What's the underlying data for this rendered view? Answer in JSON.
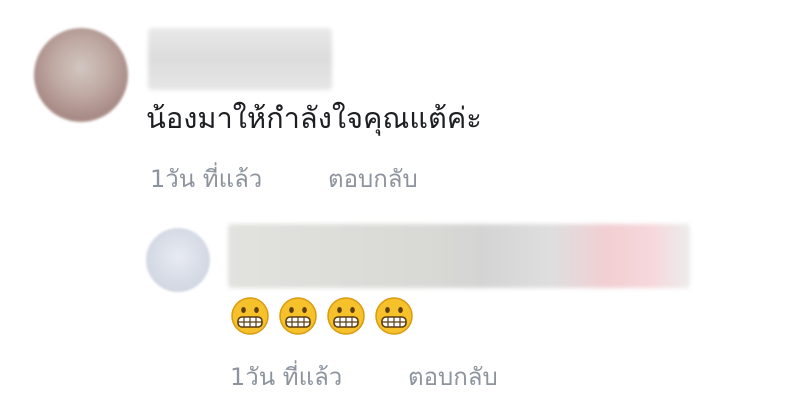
{
  "comments": [
    {
      "text": "น้องมาให้กำลังใจคุณแต้ค่ะ",
      "time": "1วัน ที่แล้ว",
      "reply_label": "ตอบกลับ"
    },
    {
      "emojis": [
        "grimacing-face-icon",
        "grimacing-face-icon",
        "grimacing-face-icon",
        "grimacing-face-icon"
      ],
      "time": "1วัน ที่แล้ว",
      "reply_label": "ตอบกลับ"
    }
  ],
  "colors": {
    "comment_text": "#1c1e21",
    "meta_text": "#8d949e",
    "emoji_face": "#f6c12a"
  }
}
